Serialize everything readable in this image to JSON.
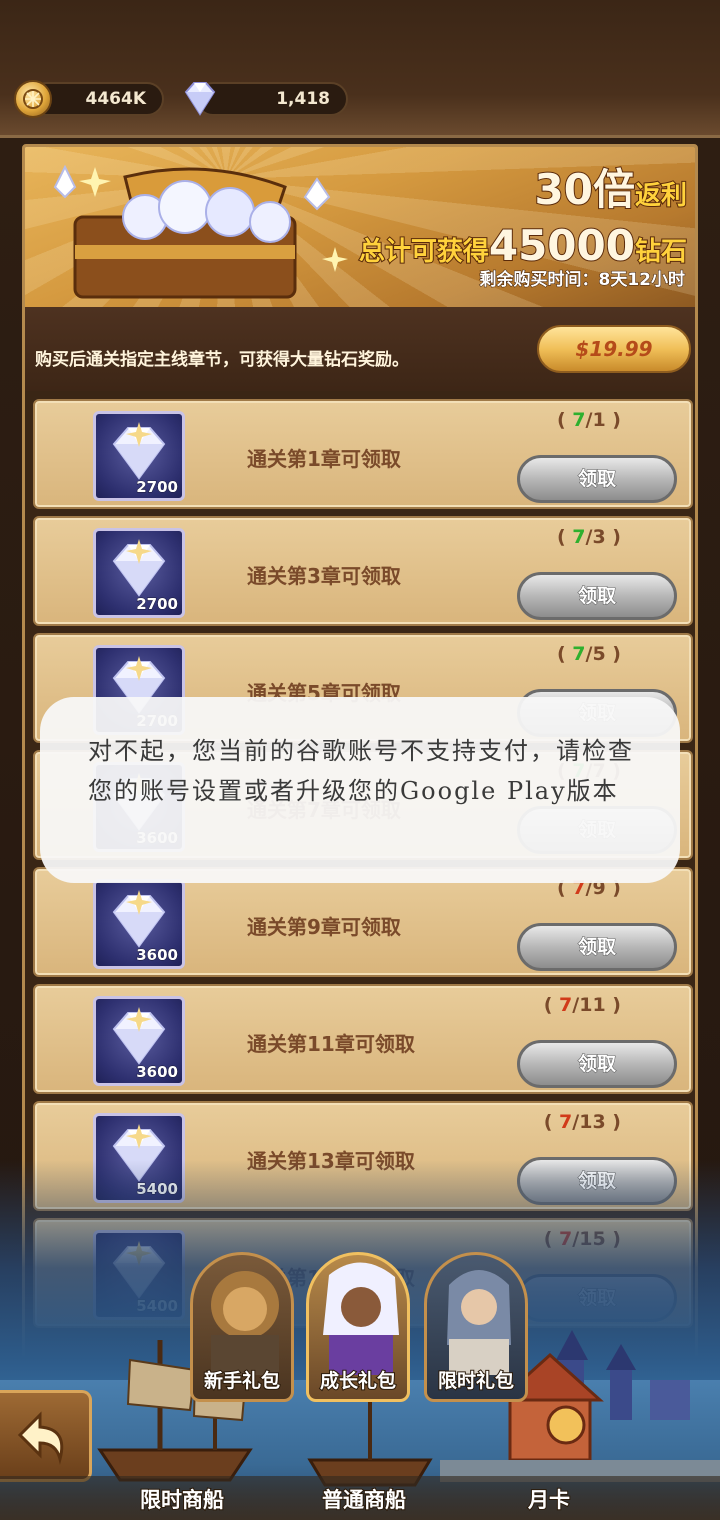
{
  "currency": {
    "gold": "4464K",
    "diamond": "1,418"
  },
  "banner": {
    "multiplier": "30倍",
    "multiplier_suffix": "返利",
    "total_prefix": "总计可获得",
    "total_amount": "45000",
    "total_suffix": "钻石",
    "remaining_time": "剩余购买时间：8天12小时"
  },
  "offer": {
    "description": "购买后通关指定主线章节，可获得大量钻石奖励。",
    "price": "$19.99"
  },
  "rewards": [
    {
      "label": "通关第1章可领取",
      "qty": "2700",
      "progress_current": "7",
      "progress_target": "1",
      "progress_color": "#2eb02e",
      "button": "领取"
    },
    {
      "label": "通关第3章可领取",
      "qty": "2700",
      "progress_current": "7",
      "progress_target": "3",
      "progress_color": "#2eb02e",
      "button": "领取"
    },
    {
      "label": "通关第5章可领取",
      "qty": "2700",
      "progress_current": "7",
      "progress_target": "5",
      "progress_color": "#2eb02e",
      "button": "领取"
    },
    {
      "label": "通关第7章可领取",
      "qty": "3600",
      "progress_current": "7",
      "progress_target": "7",
      "progress_color": "#2eb02e",
      "button": "领取"
    },
    {
      "label": "通关第9章可领取",
      "qty": "3600",
      "progress_current": "7",
      "progress_target": "9",
      "progress_color": "#d13a1a",
      "button": "领取"
    },
    {
      "label": "通关第11章可领取",
      "qty": "3600",
      "progress_current": "7",
      "progress_target": "11",
      "progress_color": "#d13a1a",
      "button": "领取"
    },
    {
      "label": "通关第13章可领取",
      "qty": "5400",
      "progress_current": "7",
      "progress_target": "13",
      "progress_color": "#d13a1a",
      "button": "领取"
    },
    {
      "label": "通关第15章可领取",
      "qty": "5400",
      "progress_current": "7",
      "progress_target": "15",
      "progress_color": "#d13a1a",
      "button": "领取"
    }
  ],
  "hero_tabs": [
    {
      "label": "新手礼包"
    },
    {
      "label": "成长礼包"
    },
    {
      "label": "限时礼包"
    }
  ],
  "nav": {
    "limited_ship": "限时商船",
    "normal_ship": "普通商船",
    "monthly_card": "月卡"
  },
  "toast": {
    "message": "对不起，您当前的谷歌账号不支持支付，请检查您的账号设置或者升级您的Google Play版本"
  }
}
